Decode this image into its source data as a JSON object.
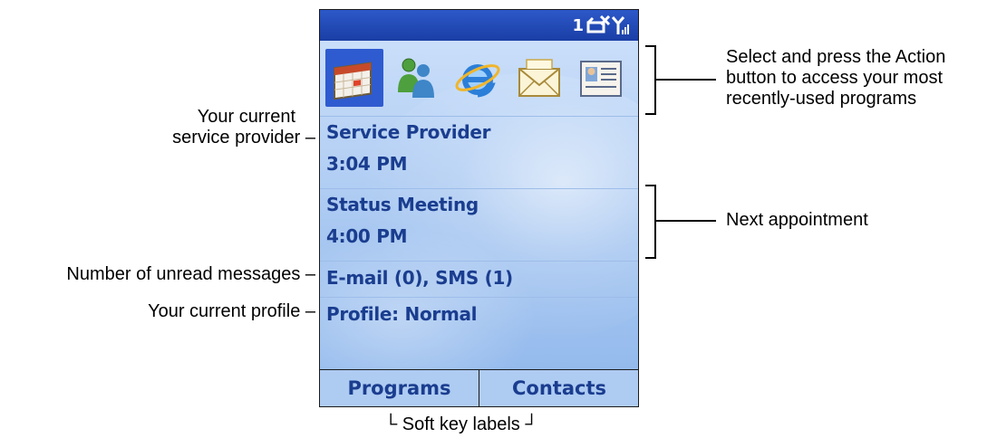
{
  "phone": {
    "status_bar": {
      "count": "1",
      "icons": [
        "connection-icon",
        "signal-icon"
      ]
    },
    "mru_icons": [
      "calendar-icon",
      "messenger-icon",
      "internet-explorer-icon",
      "inbox-icon",
      "contacts-card-icon"
    ],
    "sections": {
      "provider": {
        "name": "Service Provider",
        "time": "3:04 PM"
      },
      "appointment": {
        "title": "Status Meeting",
        "time": "4:00 PM"
      },
      "messages": "E-mail (0), SMS (1)",
      "profile": "Profile: Normal"
    },
    "softkeys": {
      "left": "Programs",
      "right": "Contacts"
    }
  },
  "callouts": {
    "recent_programs": [
      "Select and press the Action",
      "button to access your most",
      "recently-used programs"
    ],
    "service_provider": [
      "Your current",
      "service provider –"
    ],
    "next_appointment": "Next appointment",
    "unread_messages": "Number of unread messages –",
    "current_profile": "Your current profile –",
    "soft_key_labels": "└ Soft key labels ┘"
  },
  "colors": {
    "status_bar": "#1a3ea5",
    "screen_text": "#1a3d8f",
    "selection": "#2f5bd0",
    "screen_background": "#bcd5f6"
  }
}
